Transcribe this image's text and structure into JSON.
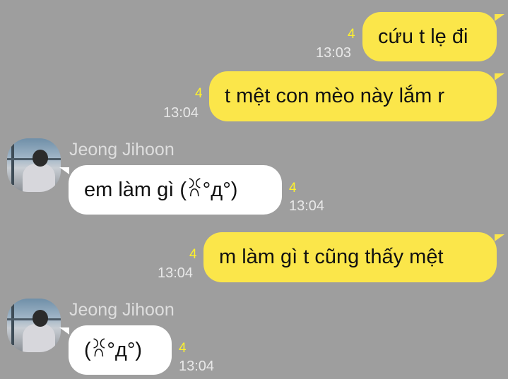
{
  "messages": [
    {
      "direction": "out",
      "text": "cứu t lẹ đi",
      "unread": "4",
      "time": "13:03"
    },
    {
      "direction": "out",
      "text": "t mệt con mèo này lắm r",
      "unread": "4",
      "time": "13:04"
    },
    {
      "direction": "in",
      "sender": "Jeong Jihoon",
      "text": "em làm gì (ꐦ°д°)",
      "unread": "4",
      "time": "13:04"
    },
    {
      "direction": "out",
      "text": "m làm gì t cũng thấy mệt",
      "unread": "4",
      "time": "13:04"
    },
    {
      "direction": "in",
      "sender": "Jeong Jihoon",
      "text": "(ꐦ°д°)",
      "unread": "4",
      "time": "13:04"
    }
  ],
  "colors": {
    "background": "#9e9e9e",
    "outgoing_bubble": "#fbe64a",
    "incoming_bubble": "#ffffff",
    "unread_count": "#fff22b"
  }
}
